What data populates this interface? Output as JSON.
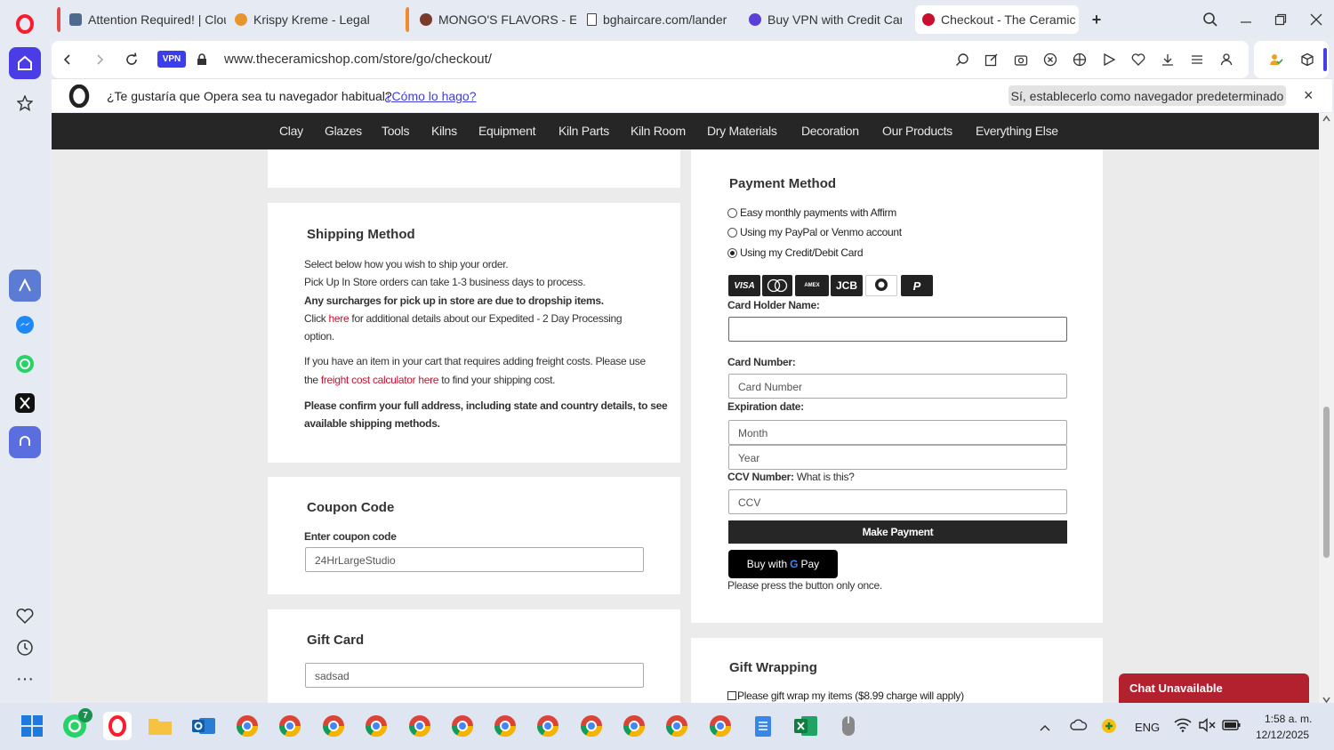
{
  "tabs": [
    {
      "title": "Attention Required! | Clou",
      "stripe": "#e04c4c",
      "favicon": "cloudflare-icon"
    },
    {
      "title": "Krispy Kreme - Legal",
      "stripe": "",
      "favicon": "krispy-kreme-icon"
    },
    {
      "title": "MONGO'S FLAVORS - E-li",
      "stripe": "#f08a2c",
      "favicon": "mongos-icon"
    },
    {
      "title": "bghaircare.com/lander",
      "stripe": "",
      "favicon": "page-icon"
    },
    {
      "title": "Buy VPN with Credit Card",
      "stripe": "",
      "favicon": "vpn-icon"
    },
    {
      "title": "Checkout - The Ceramic S",
      "stripe": "",
      "favicon": "ceramicshop-icon"
    }
  ],
  "address": {
    "vpn_badge": "VPN",
    "url": "www.theceramicshop.com/store/go/checkout/"
  },
  "prompt": {
    "question": "¿Te gustaría que Opera sea tu navegador habitual?",
    "link": "¿Cómo lo hago?",
    "button": "Sí, establecerlo como navegador predeterminado",
    "close": "×"
  },
  "nav": [
    "Clay",
    "Glazes",
    "Tools",
    "Kilns",
    "Equipment",
    "Kiln Parts",
    "Kiln Room",
    "Dry Materials",
    "Decoration",
    "Our Products",
    "Everything Else"
  ],
  "shipping": {
    "title": "Shipping Method",
    "line1": "Select below how you wish to ship your order.",
    "line2": "Pick Up In Store orders can take 1-3 business days to process.",
    "line3": "Any surcharges for pick up in store are due to dropship items.",
    "line4_pre": "Click ",
    "line4_link": "here",
    "line4_post": " for additional details about our Expedited - 2 Day Processing",
    "line5": "option.",
    "freight_pre": "If you have an item in your cart that requires adding freight costs. Please use",
    "freight_mid_pre": "the ",
    "freight_link": "freight cost calculator here",
    "freight_post": " to find your shipping cost.",
    "confirm1": "Please confirm your full address, including state and country details, to see",
    "confirm2": "available shipping methods."
  },
  "coupon": {
    "title": "Coupon Code",
    "label": "Enter coupon code",
    "value": "24HrLargeStudio"
  },
  "gift_card": {
    "title": "Gift Card",
    "value": "sadsad"
  },
  "payment": {
    "title": "Payment Method",
    "options": [
      {
        "label": "Easy monthly payments with Affirm",
        "selected": false
      },
      {
        "label": "Using my PayPal or Venmo account",
        "selected": false
      },
      {
        "label": "Using my Credit/Debit Card",
        "selected": true
      }
    ],
    "cards": [
      "VISA",
      "MC",
      "AMEX",
      "JCB",
      "Diners",
      "PayPal"
    ],
    "holder_label": "Card Holder Name:",
    "holder_value": "",
    "number_label": "Card Number:",
    "number_placeholder": "Card Number",
    "expiry_label": "Expiration date:",
    "month_placeholder": "Month",
    "year_placeholder": "Year",
    "ccv_label": "CCV Number:",
    "ccv_help": "What is this?",
    "ccv_placeholder": "CCV",
    "pay_button": "Make Payment",
    "gpay_prefix": "Buy with",
    "gpay_g": "G",
    "gpay_suffix": "Pay",
    "note": "Please press the button only once."
  },
  "gift_wrap": {
    "title": "Gift Wrapping",
    "checkbox_label": "Please gift wrap my items ($8.99 charge will apply)"
  },
  "chat": {
    "label": "Chat Unavailable"
  },
  "taskbar": {
    "whatsapp_badge": "7",
    "language": "ENG",
    "time": "1:58 a. m.",
    "date": "12/12/2025"
  },
  "colors": {
    "opera_red": "#ff1b2d",
    "nav_bg": "#262626",
    "link_red": "#c8102e",
    "chat_red": "#b3202e",
    "vpn_blue": "#3d3df0"
  }
}
